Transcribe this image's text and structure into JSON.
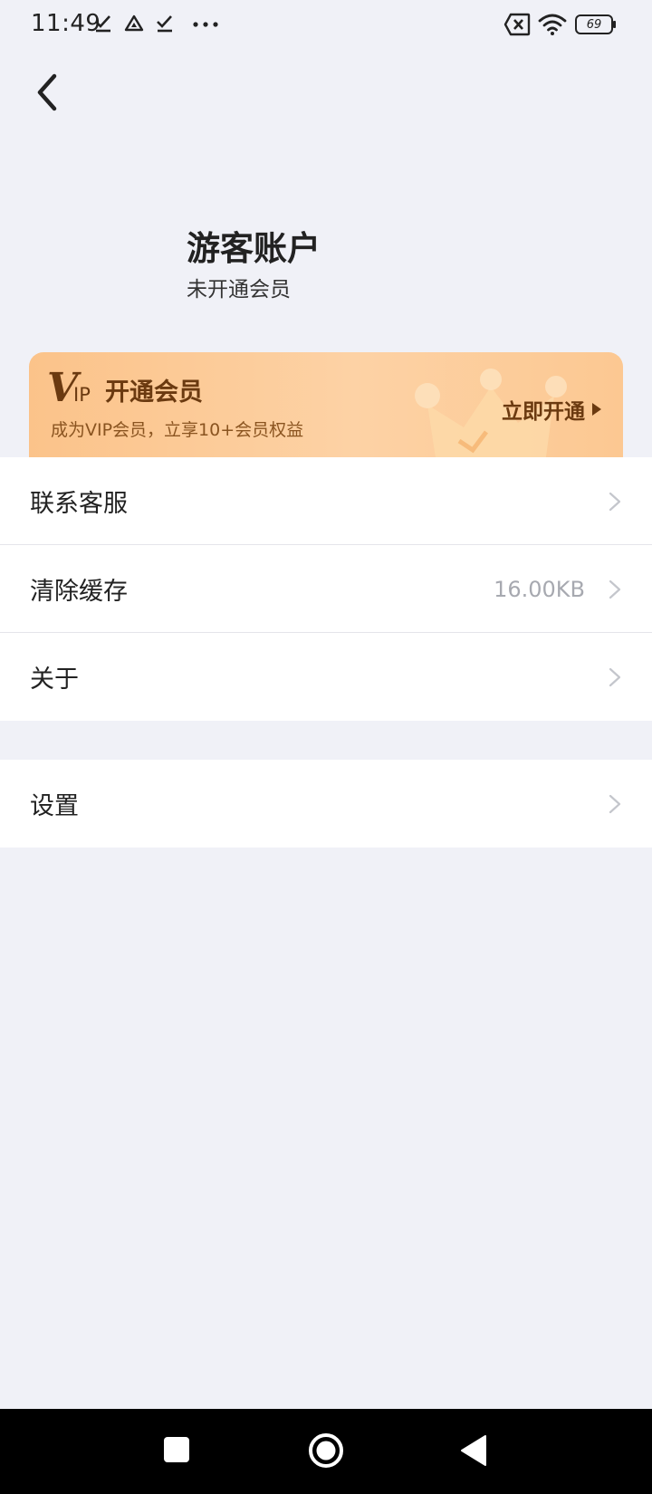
{
  "status_bar": {
    "time": "11:49",
    "battery": "69",
    "icons": [
      "check-download-icon",
      "drive-icon",
      "check-download-icon",
      "more-dots-icon",
      "no-sim-icon",
      "wifi-icon",
      "battery-icon"
    ]
  },
  "header": {
    "back_icon": "chevron-left-icon"
  },
  "profile": {
    "name": "游客账户",
    "status": "未开通会员"
  },
  "vip_banner": {
    "logo_text": "VIP",
    "title": "开通会员",
    "description": "成为VIP会员，立享10+会员权益",
    "cta_label": "立即开通"
  },
  "menu": {
    "contact": {
      "label": "联系客服"
    },
    "clear_cache": {
      "label": "清除缓存",
      "value": "16.00KB"
    },
    "about": {
      "label": "关于"
    },
    "settings": {
      "label": "设置"
    }
  },
  "nav_bar": {
    "icons": [
      "recents-square-icon",
      "home-circle-icon",
      "back-triangle-icon"
    ]
  },
  "colors": {
    "background": "#f0f1f7",
    "banner_start": "#fbc38a",
    "banner_end": "#fdd2a5",
    "banner_text": "#6b3a10",
    "secondary_text": "#a7a9b0"
  }
}
